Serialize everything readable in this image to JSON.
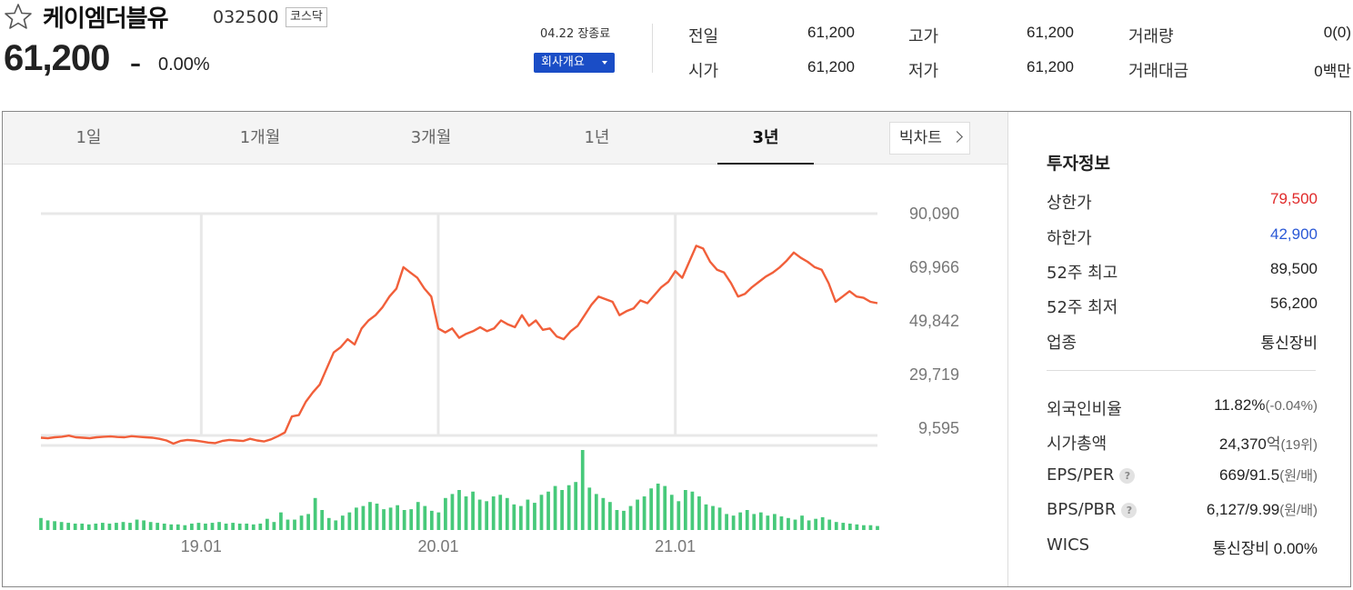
{
  "header": {
    "stock_name": "케이엠더블유",
    "stock_code": "032500",
    "market": "코스닥",
    "price": "61,200",
    "change_symbol": "–",
    "change_rate": "0.00%",
    "close_time": "04.22 장종료",
    "company_button": "회사개요",
    "quotes": [
      {
        "label": "전일",
        "value": "61,200"
      },
      {
        "label": "고가",
        "value": "61,200"
      },
      {
        "label": "거래량",
        "value": "0(0)"
      },
      {
        "label": "시가",
        "value": "61,200"
      },
      {
        "label": "저가",
        "value": "61,200"
      },
      {
        "label": "거래대금",
        "value": "0백만"
      }
    ]
  },
  "tabs": [
    {
      "label": "1일"
    },
    {
      "label": "1개월"
    },
    {
      "label": "3개월"
    },
    {
      "label": "1년"
    },
    {
      "label": "3년"
    }
  ],
  "active_tab": "3년",
  "bigchart_label": "빅차트",
  "invest": {
    "title": "투자정보",
    "upper_limit": {
      "label": "상한가",
      "value": "79,500",
      "color": "#e02a2a"
    },
    "lower_limit": {
      "label": "하한가",
      "value": "42,900",
      "color": "#2a58d6"
    },
    "high52": {
      "label": "52주 최고",
      "value": "89,500"
    },
    "low52": {
      "label": "52주 최저",
      "value": "56,200"
    },
    "industry": {
      "label": "업종",
      "value": "통신장비"
    },
    "foreign": {
      "label": "외국인비율",
      "value": "11.82%",
      "sub": "(-0.04%)"
    },
    "market_cap": {
      "label": "시가총액",
      "value": "24,370",
      "unit": "억",
      "rank": "(19위)"
    },
    "eps_per": {
      "label": "EPS/PER",
      "value": "669/91.5",
      "unit": "(원/배)"
    },
    "bps_pbr": {
      "label": "BPS/PBR",
      "value": "6,127/9.99",
      "unit": "(원/배)"
    },
    "wics": {
      "label": "WICS",
      "value": "통신장비 0.00%"
    }
  },
  "chart_data": {
    "type": "line",
    "title": "",
    "xlabel": "",
    "ylabel": "",
    "y_ticks": [
      "90,090",
      "69,966",
      "49,842",
      "29,719",
      "9,595"
    ],
    "y_tick_values": [
      90090,
      69966,
      49842,
      29719,
      9595
    ],
    "ylim": [
      9595,
      90090
    ],
    "x_ticks": [
      "19.01",
      "20.01",
      "21.01"
    ],
    "x_tick_index": [
      23,
      57,
      91
    ],
    "price_color": "#f15f3a",
    "volume_color": "#47c97a",
    "grid": true,
    "price_series": [
      6000,
      5800,
      6200,
      6400,
      6800,
      6200,
      6000,
      5800,
      6200,
      6400,
      6500,
      6300,
      6200,
      6600,
      6400,
      6200,
      6000,
      5600,
      5000,
      3800,
      4800,
      5200,
      5000,
      4600,
      4200,
      4000,
      4800,
      5200,
      5000,
      4800,
      5600,
      5000,
      4600,
      5400,
      6600,
      8000,
      14000,
      14500,
      19500,
      23000,
      26000,
      32000,
      38000,
      40000,
      43000,
      41000,
      47000,
      50000,
      52000,
      55000,
      59000,
      62000,
      70000,
      68000,
      66000,
      62000,
      59000,
      47000,
      45500,
      47000,
      43500,
      45000,
      46000,
      47500,
      46000,
      47000,
      50000,
      48500,
      47500,
      52000,
      48000,
      50000,
      46500,
      47000,
      44000,
      43000,
      46000,
      48000,
      52000,
      56000,
      59000,
      58000,
      57000,
      52000,
      53500,
      54500,
      57500,
      56500,
      59500,
      62500,
      64500,
      68500,
      66000,
      72000,
      78000,
      77000,
      72000,
      69000,
      68000,
      64000,
      59000,
      60000,
      62500,
      64500,
      66500,
      68000,
      70000,
      72500,
      75500,
      73500,
      72000,
      70000,
      69000,
      64000,
      57000,
      59000,
      61000,
      59000,
      58500,
      57000,
      56500
    ],
    "volume_series": [
      15,
      12,
      11,
      10,
      9,
      8,
      8,
      7,
      8,
      9,
      8,
      9,
      10,
      9,
      13,
      12,
      10,
      9,
      8,
      7,
      7,
      6,
      8,
      9,
      8,
      9,
      10,
      8,
      9,
      8,
      8,
      7,
      8,
      14,
      10,
      22,
      13,
      13,
      18,
      20,
      40,
      25,
      15,
      12,
      18,
      22,
      28,
      30,
      35,
      33,
      26,
      28,
      31,
      25,
      26,
      35,
      30,
      24,
      22,
      40,
      45,
      50,
      42,
      48,
      38,
      36,
      42,
      44,
      40,
      32,
      30,
      38,
      34,
      44,
      48,
      55,
      50,
      56,
      60,
      100,
      53,
      45,
      40,
      35,
      25,
      24,
      30,
      38,
      42,
      52,
      58,
      55,
      44,
      36,
      50,
      48,
      42,
      32,
      30,
      28,
      20,
      18,
      22,
      25,
      20,
      22,
      18,
      20,
      17,
      15,
      13,
      18,
      12,
      14,
      16,
      13,
      10,
      9,
      8,
      7,
      6,
      6,
      5
    ]
  }
}
